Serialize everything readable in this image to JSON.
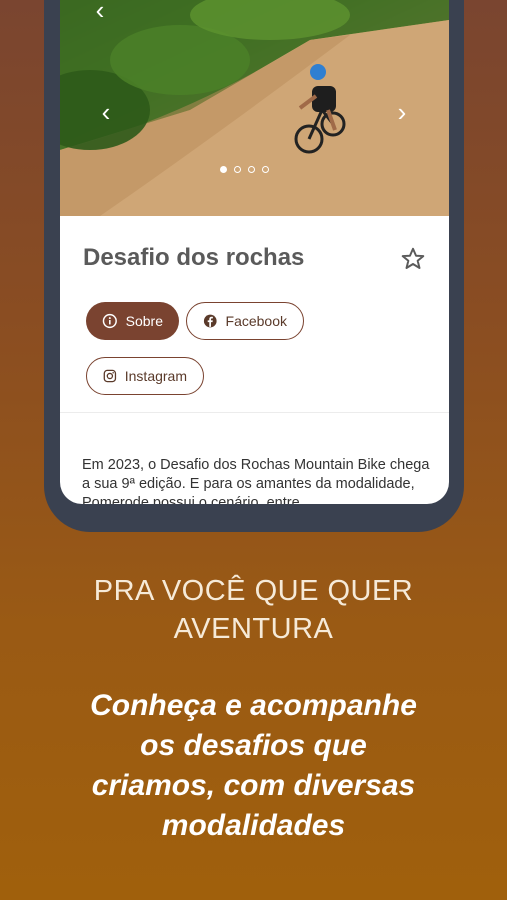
{
  "event": {
    "title": "Desafio dos rochas",
    "description": "Em 2023, o Desafio dos Rochas Mountain Bike chega a sua 9ª edição. E para os amantes da modalidade, Pomerode possui o cenário, entre"
  },
  "carousel": {
    "total": 4,
    "active": 0
  },
  "tabs": [
    {
      "label": "Sobre",
      "icon": "info-icon",
      "active": true
    },
    {
      "label": "Facebook",
      "icon": "facebook-icon",
      "active": false
    },
    {
      "label": "Instagram",
      "icon": "instagram-icon",
      "active": false
    }
  ],
  "promo": {
    "tagline_line1": "PRA VOCÊ QUE QUER",
    "tagline_line2": "AVENTURA",
    "headline_line1": "Conheça e acompanhe",
    "headline_line2": "os desafios que",
    "headline_line3": "criamos, com diversas",
    "headline_line4": "modalidades"
  },
  "colors": {
    "accent": "#7a4330",
    "background_top": "#7a4530",
    "background_bottom": "#a0600c"
  }
}
